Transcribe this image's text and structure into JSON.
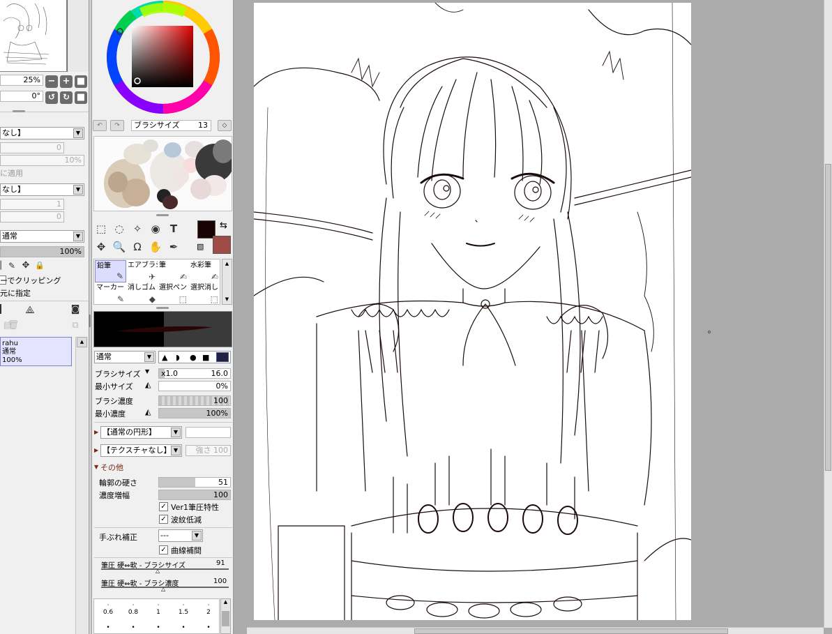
{
  "navigator": {
    "zoom": "25%",
    "rotation": "0°"
  },
  "layer_props": {
    "texture_combo": "なし】",
    "field1": "0",
    "field2": "10%",
    "apply_label": "に適用",
    "effect_combo": "なし】",
    "field3": "1",
    "field4": "0",
    "blend_combo": "通常",
    "opacity": "100%",
    "clip_label": "ーでクリッピング",
    "source_label": "元に指定"
  },
  "layer": {
    "name": "rahu",
    "mode": "通常",
    "opacity": "100%"
  },
  "brush_toolbar": {
    "size_label": "ブラシサイズ",
    "size_value": "13"
  },
  "colors": {
    "foreground": "#1a0303",
    "background": "#9e4c45"
  },
  "brushes": [
    {
      "label": "鉛筆",
      "selected": true
    },
    {
      "label": "エアブラシ",
      "selected": false
    },
    {
      "label": "筆",
      "selected": false
    },
    {
      "label": "水彩筆",
      "selected": false
    },
    {
      "label": "マーカー",
      "selected": false
    },
    {
      "label": "消しゴム",
      "selected": false
    },
    {
      "label": "選択ペン",
      "selected": false
    },
    {
      "label": "選択消し",
      "selected": false
    }
  ],
  "brush_settings": {
    "blend_mode": "通常",
    "size_label": "ブラシサイズ",
    "size_mult": "x1.0",
    "size_value": "16.0",
    "min_size_label": "最小サイズ",
    "min_size_value": "0%",
    "density_label": "ブラシ濃度",
    "density_value": "100",
    "min_density_label": "最小濃度",
    "min_density_value": "100%",
    "shape_combo": "【通常の円形】",
    "texture_combo": "【テクスチャなし】",
    "texture_strength": "強さ 100",
    "other_label": "その他",
    "edge_label": "輪郭の硬さ",
    "edge_value": "51",
    "density_gain_label": "濃度増幅",
    "density_gain_value": "100",
    "ver1_label": "Ver1筆圧特性",
    "ripple_label": "波紋低減",
    "stabilizer_label": "手ぶれ補正",
    "stabilizer_value": "---",
    "curve_label": "曲線補間",
    "pressure_size_label": "筆圧 硬⇔軟 - ブラシサイズ",
    "pressure_size_value": "91",
    "pressure_density_label": "筆圧 硬⇔軟 - ブラシ濃度",
    "pressure_density_value": "100"
  },
  "dot_sizes": [
    "0.6",
    "0.8",
    "1",
    "1.5",
    "2"
  ]
}
